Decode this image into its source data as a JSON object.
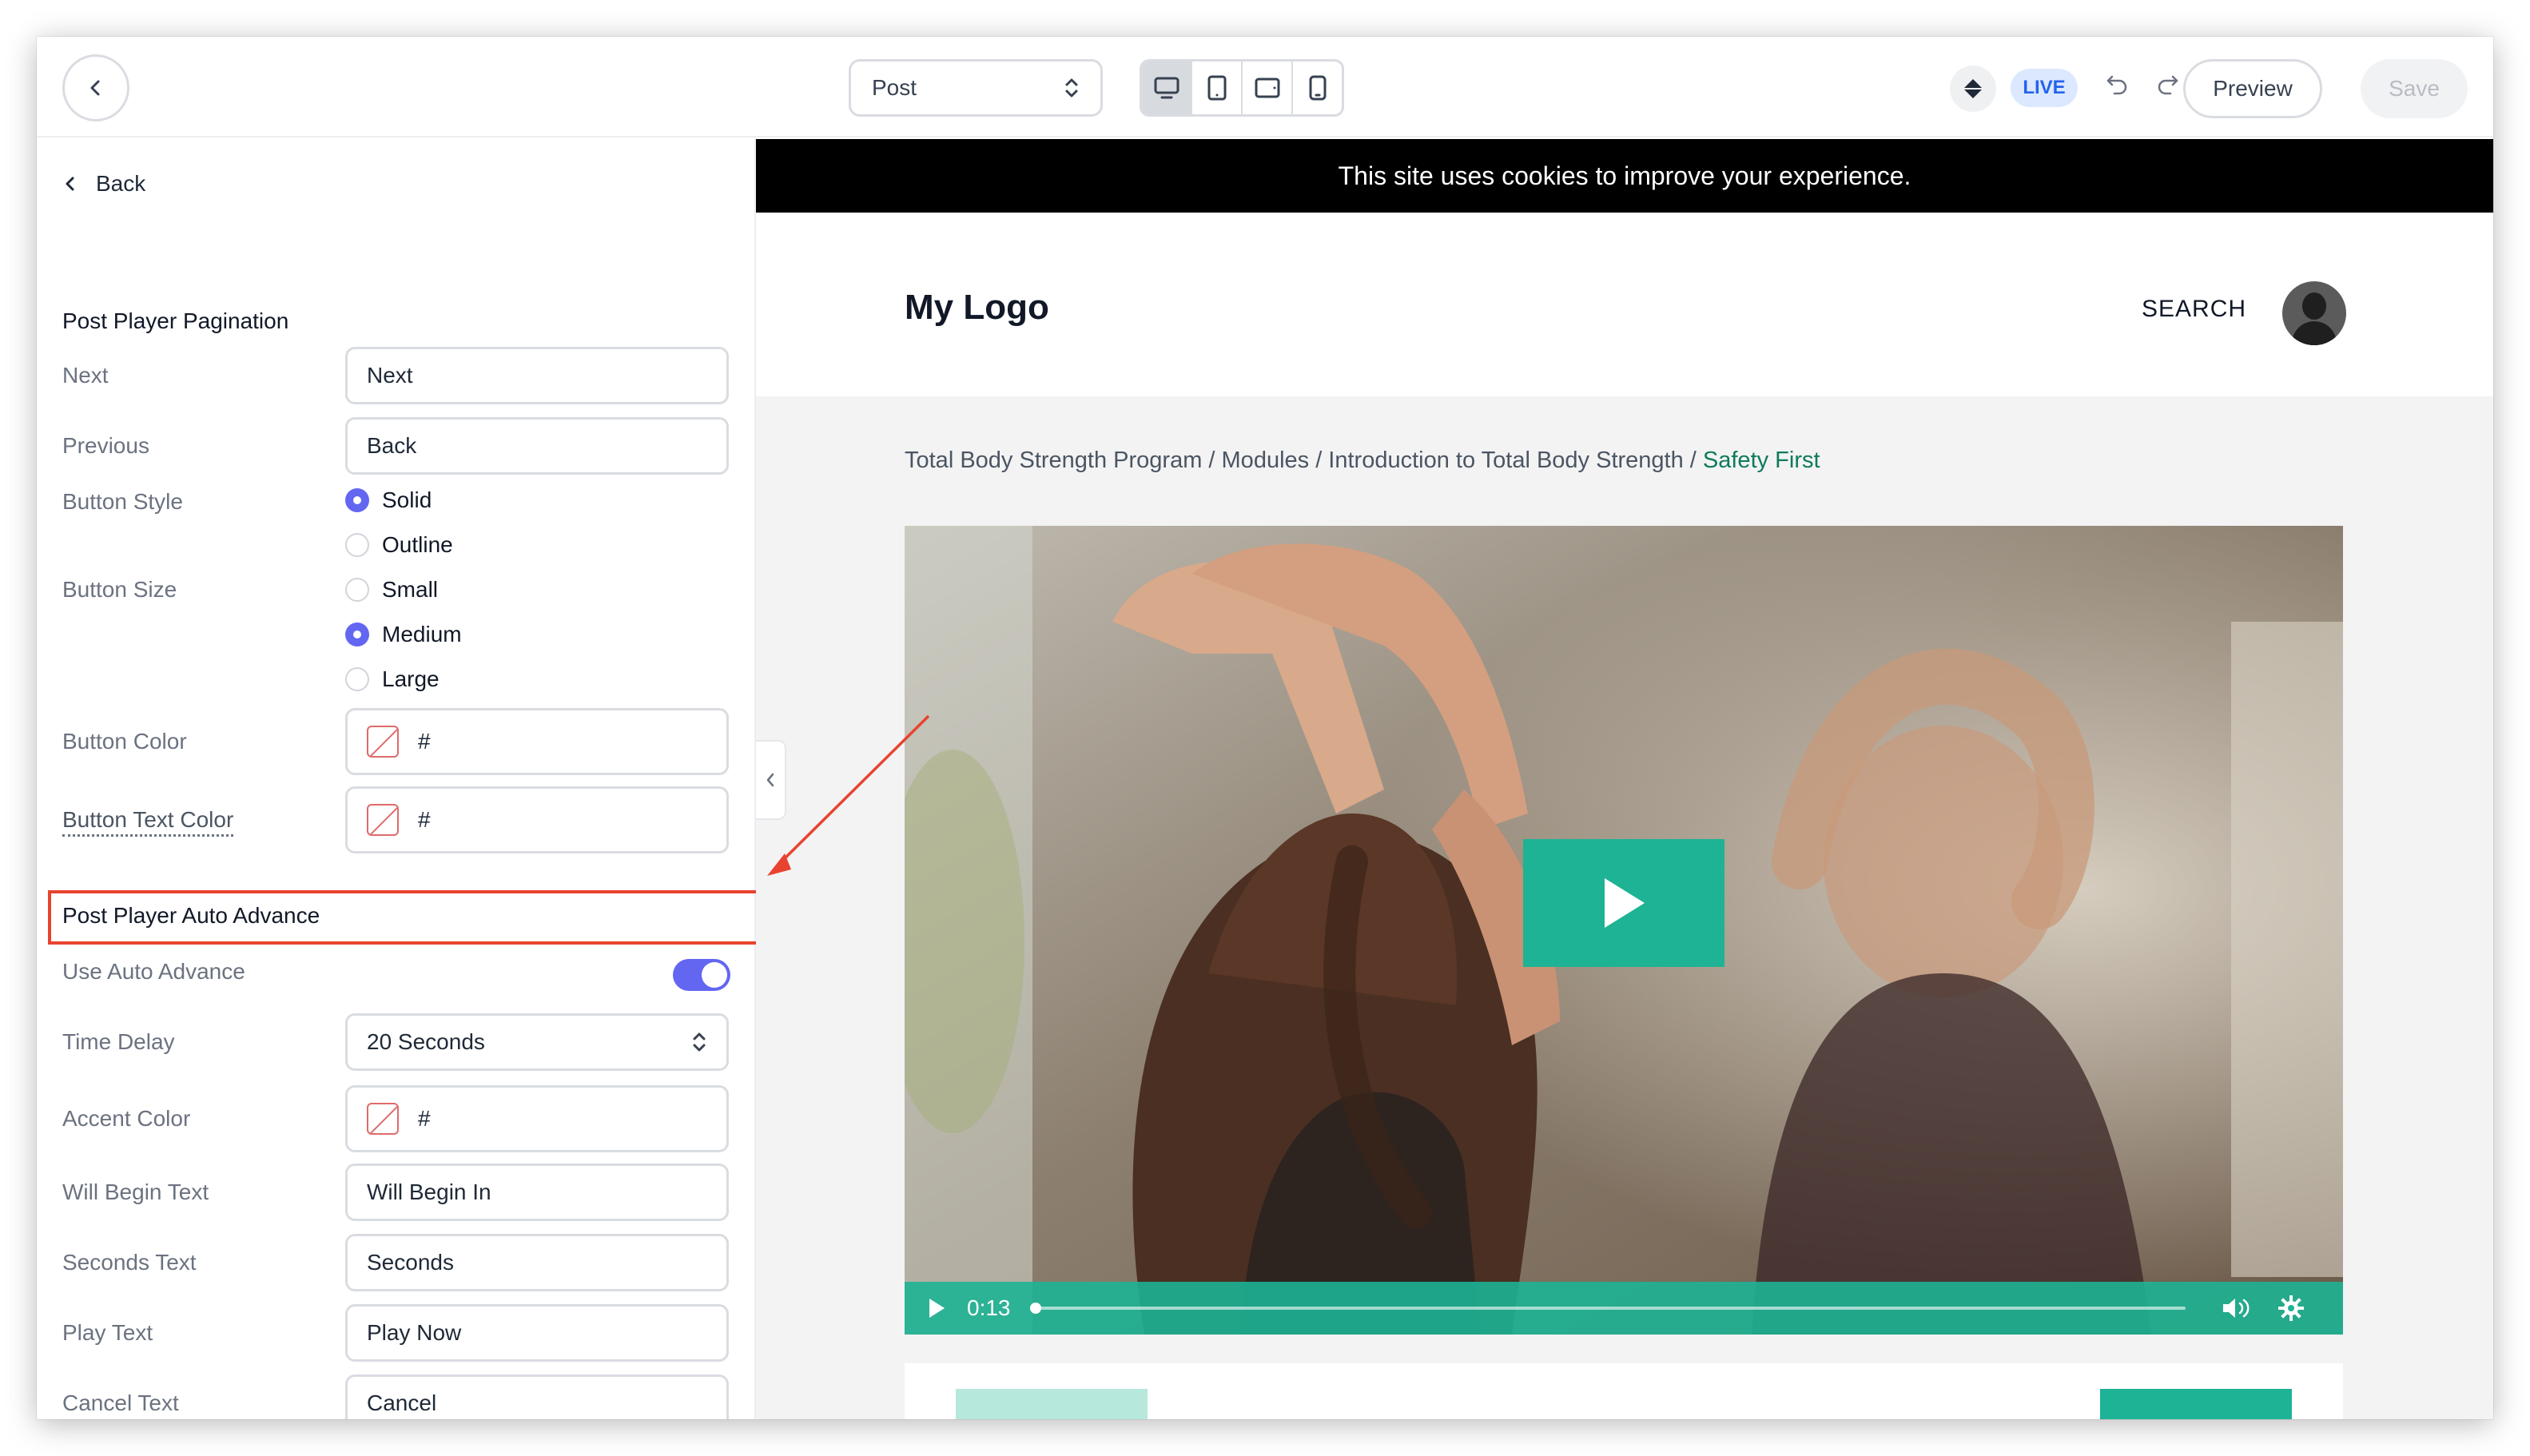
{
  "topbar": {
    "page_select_value": "Post",
    "preview_label": "Preview",
    "save_label": "Save",
    "live_badge": "LIVE"
  },
  "panel": {
    "back_label": "Back",
    "pagination": {
      "title": "Post Player Pagination",
      "next_label": "Next",
      "next_value": "Next",
      "previous_label": "Previous",
      "previous_value": "Back",
      "button_style_label": "Button Style",
      "button_style_options": [
        "Solid",
        "Outline"
      ],
      "button_style_selected": "Solid",
      "button_size_label": "Button Size",
      "button_size_options": [
        "Small",
        "Medium",
        "Large"
      ],
      "button_size_selected": "Medium",
      "button_color_label": "Button Color",
      "button_color_value": "#",
      "button_text_color_label": "Button Text Color",
      "button_text_color_value": "#"
    },
    "auto_advance": {
      "title": "Post Player Auto Advance",
      "use_label": "Use Auto Advance",
      "use_enabled": true,
      "time_delay_label": "Time Delay",
      "time_delay_value": "20 Seconds",
      "accent_color_label": "Accent Color",
      "accent_color_value": "#",
      "will_begin_label": "Will Begin Text",
      "will_begin_value": "Will Begin In",
      "seconds_label": "Seconds Text",
      "seconds_value": "Seconds",
      "play_label": "Play Text",
      "play_value": "Play Now",
      "cancel_label": "Cancel Text",
      "cancel_value": "Cancel"
    }
  },
  "site": {
    "cookie_text": "This site uses cookies to improve your experience.",
    "logo": "My Logo",
    "search_label": "SEARCH",
    "breadcrumb": {
      "trail": "Total Body Strength Program / Modules / Introduction to Total Body Strength / ",
      "current": "Safety First"
    },
    "video": {
      "time": "0:13",
      "accent_color": "#1db394"
    }
  },
  "colors": {
    "accent_purple": "#6366f1",
    "highlight_red": "#e8432f",
    "video_teal": "#1db394"
  }
}
